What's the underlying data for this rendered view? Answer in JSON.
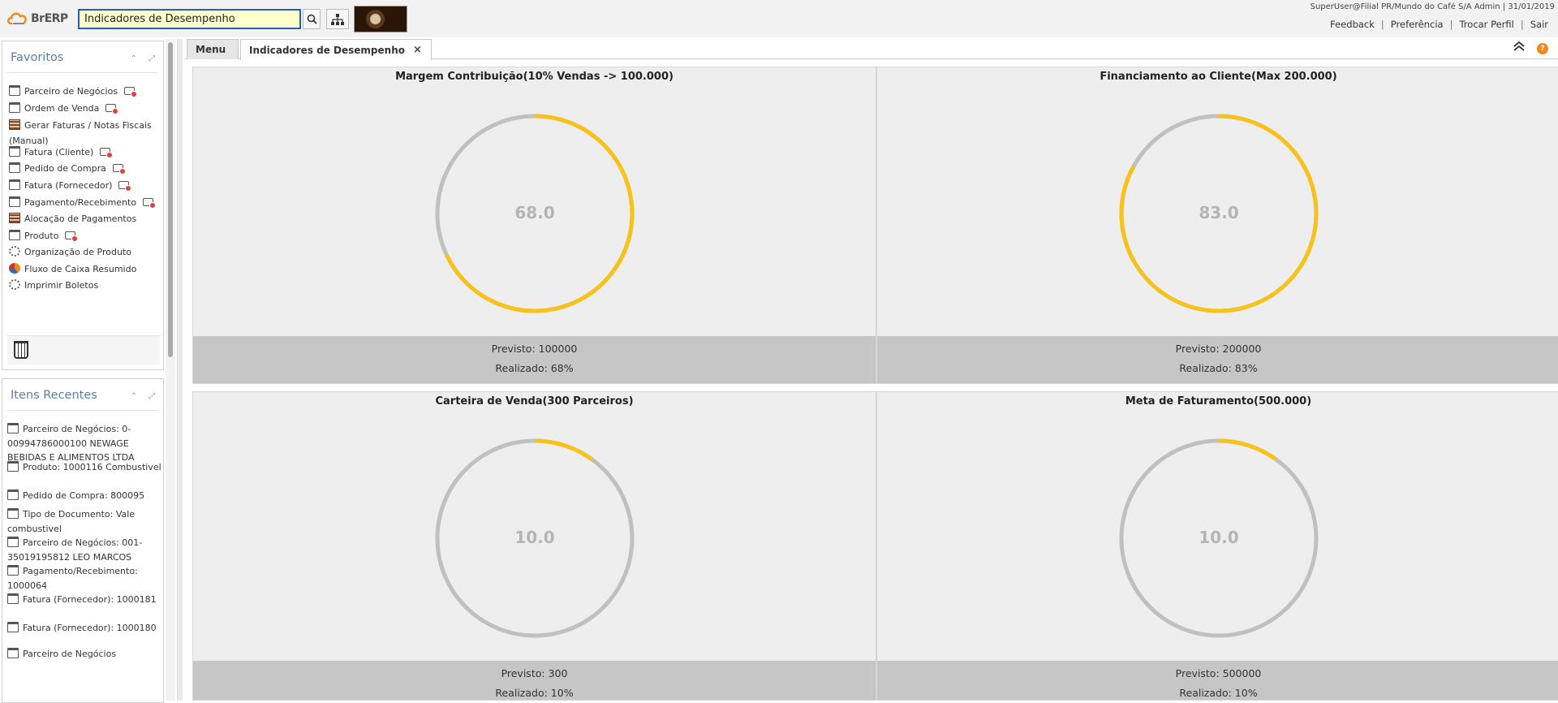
{
  "header": {
    "search_value": "Indicadores de Desempenho",
    "user_info": "SuperUser@Filial PR/Mundo do Café S/A Admin | 31/01/2019",
    "links": [
      "Feedback",
      "Preferência",
      "Trocar Perfil",
      "Sair"
    ]
  },
  "logo": {
    "text": "BrERP",
    "icon": "cloud-logo-icon"
  },
  "favorites": {
    "title": "Favoritos",
    "items": [
      {
        "label": "Parceiro de Negócios",
        "icon": "window-icon",
        "new": true
      },
      {
        "label": "Ordem de Venda",
        "icon": "window-icon",
        "new": true
      },
      {
        "label": "Gerar Faturas / Notas Fiscais (Manual)",
        "icon": "process-grid-icon",
        "new": false
      },
      {
        "label": "Fatura (Cliente)",
        "icon": "window-icon",
        "new": true
      },
      {
        "label": "Pedido de Compra",
        "icon": "window-icon",
        "new": true
      },
      {
        "label": "Fatura (Fornecedor)",
        "icon": "window-icon",
        "new": true
      },
      {
        "label": "Pagamento/Recebimento",
        "icon": "window-icon",
        "new": true
      },
      {
        "label": "Alocação de Pagamentos",
        "icon": "process-grid-icon",
        "new": false
      },
      {
        "label": "Produto",
        "icon": "window-icon",
        "new": true
      },
      {
        "label": "Organização de Produto",
        "icon": "gear-icon",
        "new": false
      },
      {
        "label": "Fluxo de Caixa Resumido",
        "icon": "pie-chart-icon",
        "new": false
      },
      {
        "label": "Imprimir Boletos",
        "icon": "gear-icon",
        "new": false
      }
    ]
  },
  "recent": {
    "title": "Itens Recentes",
    "items": [
      {
        "label": "Parceiro de Negócios: 0-00994786000100 NEWAGE BEBIDAS E ALIMENTOS LTDA"
      },
      {
        "label": "Produto: 1000116 Combustivel"
      },
      {
        "label": "Pedido de Compra: 800095"
      },
      {
        "label": "Tipo de Documento: Vale combustivel"
      },
      {
        "label": "Parceiro de Negócios: 001-35019195812 LEO MARCOS"
      },
      {
        "label": "Pagamento/Recebimento: 1000064"
      },
      {
        "label": "Fatura (Fornecedor): 1000181"
      },
      {
        "label": "Fatura (Fornecedor): 1000180"
      },
      {
        "label": "Parceiro de Negócios"
      }
    ]
  },
  "tabs": [
    {
      "label": "Menu",
      "active": false
    },
    {
      "label": "Indicadores de Desempenho",
      "active": true,
      "close": "×"
    }
  ],
  "help_label": "?",
  "colors": {
    "accent": "#f9c21a",
    "track": "#c0c0c0",
    "value_text": "#b5b5b5",
    "footer": "#c6c6c6"
  },
  "kpis": [
    {
      "title": "Margem Contribuição(10% Vendas -> 100.000)",
      "value": "68.0",
      "fraction": 0.68,
      "previsto": "Previsto: 100000",
      "realizado": "Realizado: 68%"
    },
    {
      "title": "Financiamento ao Cliente(Max 200.000)",
      "value": "83.0",
      "fraction": 0.83,
      "previsto": "Previsto: 200000",
      "realizado": "Realizado: 83%"
    },
    {
      "title": "Carteira de Venda(300 Parceiros)",
      "value": "10.0",
      "fraction": 0.1,
      "previsto": "Previsto: 300",
      "realizado": "Realizado: 10%"
    },
    {
      "title": "Meta de Faturamento(500.000)",
      "value": "10.0",
      "fraction": 0.1,
      "previsto": "Previsto: 500000",
      "realizado": "Realizado: 10%"
    }
  ]
}
